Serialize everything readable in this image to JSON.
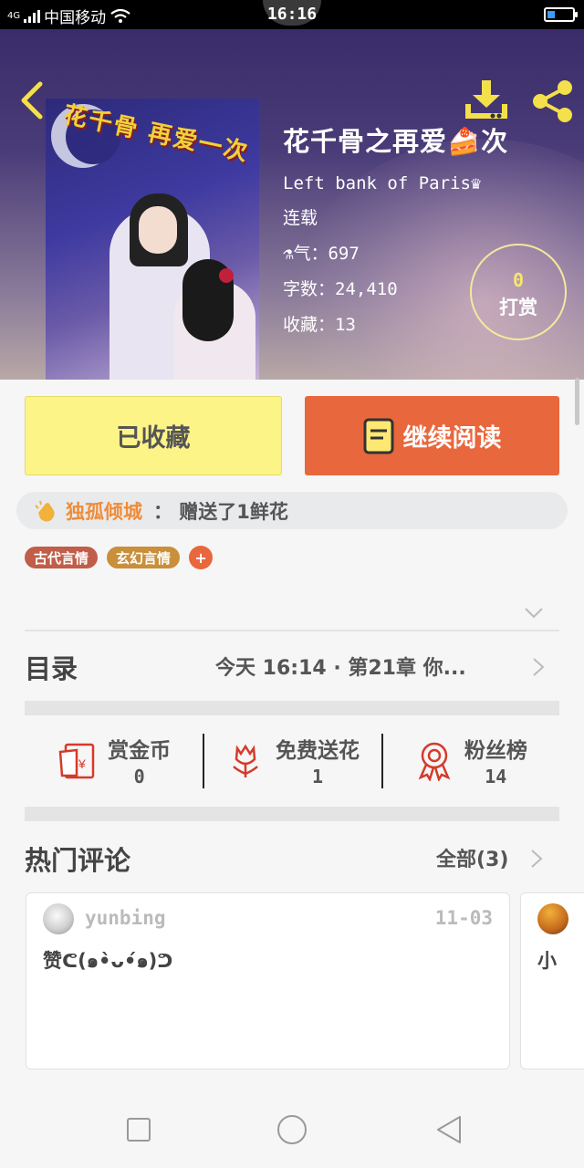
{
  "status_bar": {
    "network": "4G",
    "carrier": "中国移动",
    "time": "16:16"
  },
  "header": {
    "book_title": "花千骨之再爱🍰次",
    "author": "Left bank of Paris♛",
    "status": "连载",
    "popularity_key": "⚗气：",
    "popularity": "697",
    "word_count_key": "字数：",
    "word_count": "24,410",
    "favorites_key": "收藏：",
    "favorites": "13",
    "tip_count": "0",
    "tip_label": "打赏",
    "cover_title": "花千骨 再爱一次"
  },
  "actions": {
    "favorited_label": "已收藏",
    "continue_label": "继续阅读"
  },
  "notice": {
    "user": "独孤倾城",
    "text": "：  赠送了1鲜花"
  },
  "tags": [
    "古代言情",
    "玄幻言情",
    "+"
  ],
  "toc": {
    "label": "目录",
    "latest": "今天 16:14 · 第21章 你..."
  },
  "stats": [
    {
      "label": "赏金币",
      "value": "0",
      "icon": "red-envelope-icon"
    },
    {
      "label": "免费送花",
      "value": "1",
      "icon": "flower-icon"
    },
    {
      "label": "粉丝榜",
      "value": "14",
      "icon": "medal-icon"
    }
  ],
  "comments_section": {
    "label": "热门评论",
    "all_label": "全部(3)",
    "comments": [
      {
        "user": "yunbing",
        "date": "11-03",
        "text": "赞ᕦ(๑•̀ᴗ•́๑)ᕤ"
      },
      {
        "user": "",
        "date": "",
        "text": "小"
      }
    ]
  },
  "colors": {
    "accent_orange": "#e9673c",
    "favorite_yellow": "#fcf487",
    "notice_user": "#ee8c3a",
    "tag_ancient": "#c05e49",
    "tag_fantasy": "#c98f3a"
  }
}
